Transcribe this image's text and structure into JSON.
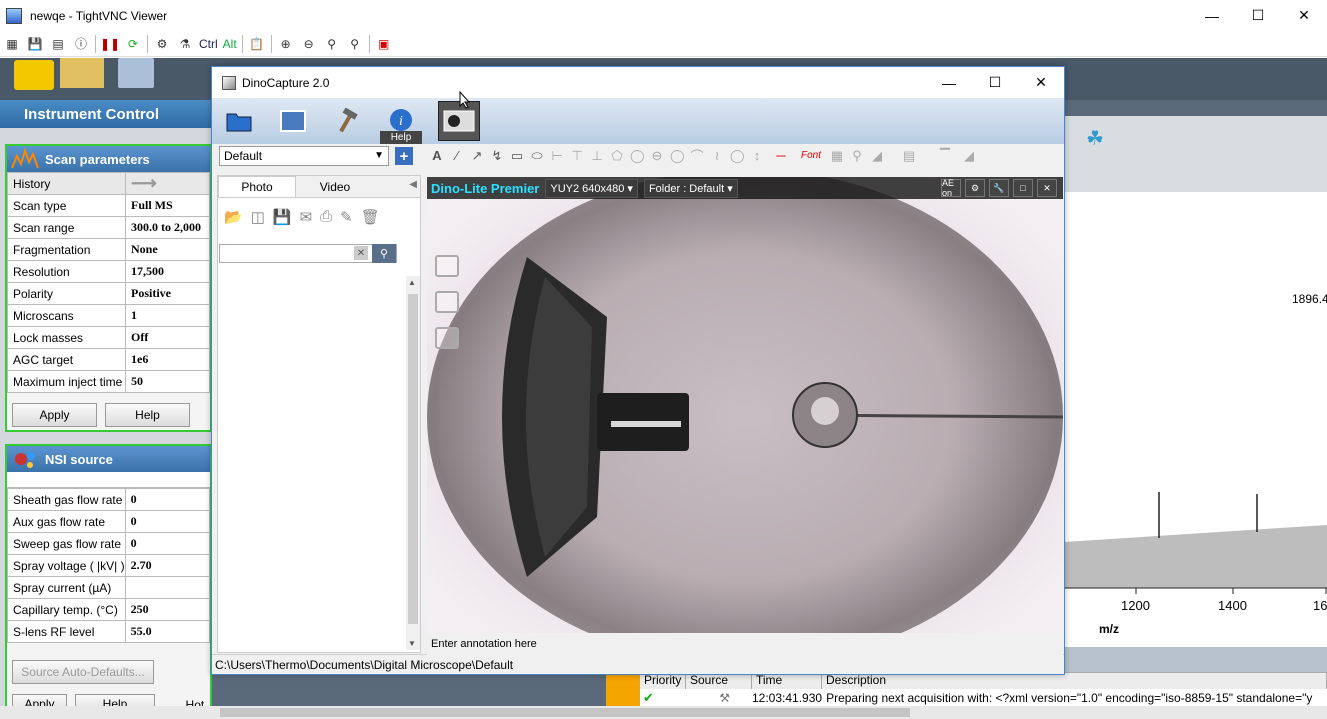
{
  "vnc": {
    "title": "newqe - TightVNC Viewer",
    "toolbar_ctrl": "Ctrl",
    "toolbar_alt": "Alt"
  },
  "instrument": {
    "header": "Instrument Control",
    "scan": {
      "title": "Scan parameters",
      "rows": [
        {
          "label": "History",
          "value": ""
        },
        {
          "label": "Scan type",
          "value": "Full MS"
        },
        {
          "label": "Scan range",
          "value": "300.0 to 2,000"
        },
        {
          "label": "Fragmentation",
          "value": "None"
        },
        {
          "label": "Resolution",
          "value": "17,500"
        },
        {
          "label": "Polarity",
          "value": "Positive"
        },
        {
          "label": "Microscans",
          "value": "1"
        },
        {
          "label": "Lock masses",
          "value": "Off"
        },
        {
          "label": "AGC target",
          "value": "1e6"
        },
        {
          "label": "Maximum inject time",
          "value": "50"
        }
      ],
      "apply_label": "Apply",
      "help_label": "Help"
    },
    "nsi": {
      "title": "NSI source",
      "rows": [
        {
          "label": "Sheath gas flow rate",
          "value": "0"
        },
        {
          "label": "Aux gas flow rate",
          "value": "0"
        },
        {
          "label": "Sweep gas flow rate",
          "value": "0"
        },
        {
          "label": "Spray voltage ( |kV| )",
          "value": "2.70"
        },
        {
          "label": "Spray current (µA)",
          "value": ""
        },
        {
          "label": "Capillary temp. (°C)",
          "value": "250"
        },
        {
          "label": "S-lens RF level",
          "value": "55.0"
        }
      ],
      "auto_defaults_label": "Source Auto-Defaults...",
      "apply_label": "Apply",
      "help_label": "Help",
      "hot_link_label": "Hot link"
    }
  },
  "spectrum": {
    "peak_label": "1896.4",
    "x_ticks": [
      "1200",
      "1400",
      "16"
    ],
    "x_label": "m/z"
  },
  "log": {
    "headers": [
      "Priority",
      "Source",
      "Time",
      "Description"
    ],
    "row": {
      "time": "12:03:41.930",
      "description": "Preparing next acquisition with: <?xml version=\"1.0\" encoding=\"iso-8859-15\" standalone=\"y"
    }
  },
  "dino": {
    "title": "DinoCapture 2.0",
    "help_label": "Help",
    "profile": "Default",
    "tabs": [
      "Photo",
      "Video"
    ],
    "brand": "Dino-Lite Premier",
    "resolution": "YUY2 640x480",
    "folder": "Folder : Default",
    "ae_label": "AE on",
    "annotation_placeholder": "Enter annotation here",
    "status_path": "C:\\Users\\Thermo\\Documents\\Digital Microscope\\Default"
  }
}
